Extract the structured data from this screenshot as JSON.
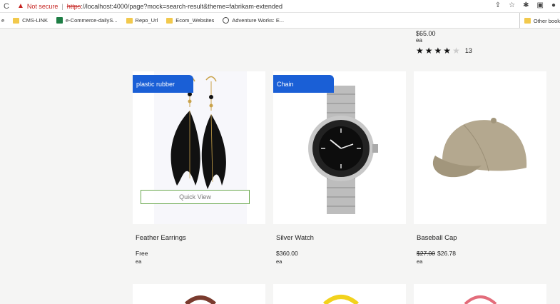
{
  "browser": {
    "reload_icon": "reload-icon",
    "not_secure": "Not secure",
    "separator": "|",
    "url_protocol": "https",
    "url_rest": "://localhost:4000/page?mock=search-result&theme=fabrikam-extended",
    "bookmarks": [
      {
        "label": "e",
        "icon": "none"
      },
      {
        "label": "CMS-LINK",
        "icon": "folder"
      },
      {
        "label": "e-Commerce-dailyS...",
        "icon": "spreadsheet"
      },
      {
        "label": "Repo_Url",
        "icon": "folder"
      },
      {
        "label": "Ecom_Websites",
        "icon": "folder"
      },
      {
        "label": "Adventure Works: E...",
        "icon": "globe"
      }
    ],
    "other_bookmarks": "Other book"
  },
  "top_product": {
    "price": "$65.00",
    "unit": "ea",
    "rating": 4,
    "rating_max": 5,
    "review_count": "13"
  },
  "products": [
    {
      "tag": "plastic rubber",
      "name": "Feather Earrings",
      "price": "Free",
      "old_price": "",
      "unit": "ea",
      "quick_view": "Quick View"
    },
    {
      "tag": "Chain",
      "name": "Silver Watch",
      "price": "$360.00",
      "old_price": "",
      "unit": "ea"
    },
    {
      "tag": "",
      "name": "Baseball Cap",
      "price": "$26.78",
      "old_price": "$27.00",
      "unit": "ea"
    }
  ],
  "colors": {
    "tag_bg": "#1a5fd6",
    "quick_view_border": "#6aa84f",
    "page_bg": "#f5f5f4"
  }
}
